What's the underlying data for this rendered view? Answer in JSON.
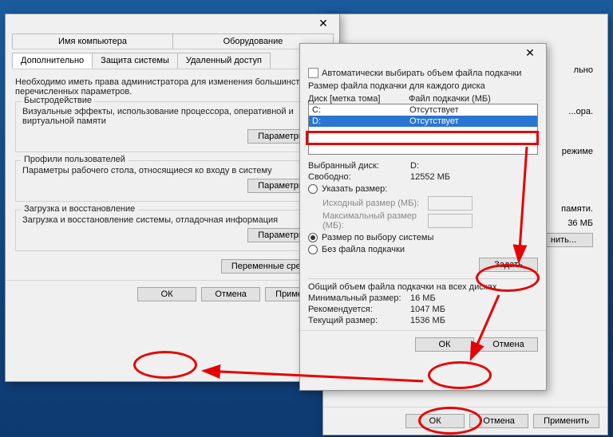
{
  "win1": {
    "tabs_row1": [
      "Имя компьютера",
      "Оборудование"
    ],
    "tabs_row2": [
      "Дополнительно",
      "Защита системы",
      "Удаленный доступ"
    ],
    "intro": "Необходимо иметь права администратора для изменения большинства перечисленных параметров.",
    "perf": {
      "title": "Быстродействие",
      "desc": "Визуальные эффекты, использование процессора, оперативной и виртуальной памяти",
      "btn": "Параметры..."
    },
    "profiles": {
      "title": "Профили пользователей",
      "desc": "Параметры рабочего стола, относящиеся ко входу в систему",
      "btn": "Параметры..."
    },
    "startup": {
      "title": "Загрузка и восстановление",
      "desc": "Загрузка и восстановление системы, отладочная информация",
      "btn": "Параметры..."
    },
    "env_btn": "Переменные среды...",
    "ok": "ОК",
    "cancel": "Отмена",
    "apply": "Применить"
  },
  "win2": {
    "tab": "льно",
    "intro1": "...ора.",
    "param_btn": "режиме",
    "memory": "памяти.",
    "size": "36 МБ",
    "change_btn": "нить...",
    "ok": "ОК",
    "cancel": "Отмена",
    "apply": "Применить"
  },
  "dlg": {
    "auto_label": "Автоматически выбирать объем файла подкачки",
    "list_title": "Размер файла подкачки для каждого диска",
    "col_drive": "Диск [метка тома]",
    "col_file": "Файл подкачки (МБ)",
    "rows": [
      {
        "drive": "C:",
        "file": "Отсутствует"
      },
      {
        "drive": "D:",
        "file": "Отсутствует"
      }
    ],
    "sel_label": "Выбранный диск:",
    "sel_value": "D:",
    "free_label": "Свободно:",
    "free_value": "12552 МБ",
    "opt_custom": "Указать размер:",
    "initial": "Исходный размер (МБ):",
    "maximum": "Максимальный размер (МБ):",
    "opt_system": "Размер по выбору системы",
    "opt_none": "Без файла подкачки",
    "set_btn": "Задать",
    "total_title": "Общий объем файла подкачки на всех дисках",
    "min_label": "Минимальный размер:",
    "min_value": "16 МБ",
    "rec_label": "Рекомендуется:",
    "rec_value": "1047 МБ",
    "cur_label": "Текущий размер:",
    "cur_value": "1536 МБ",
    "ok": "ОК",
    "cancel": "Отмена"
  }
}
